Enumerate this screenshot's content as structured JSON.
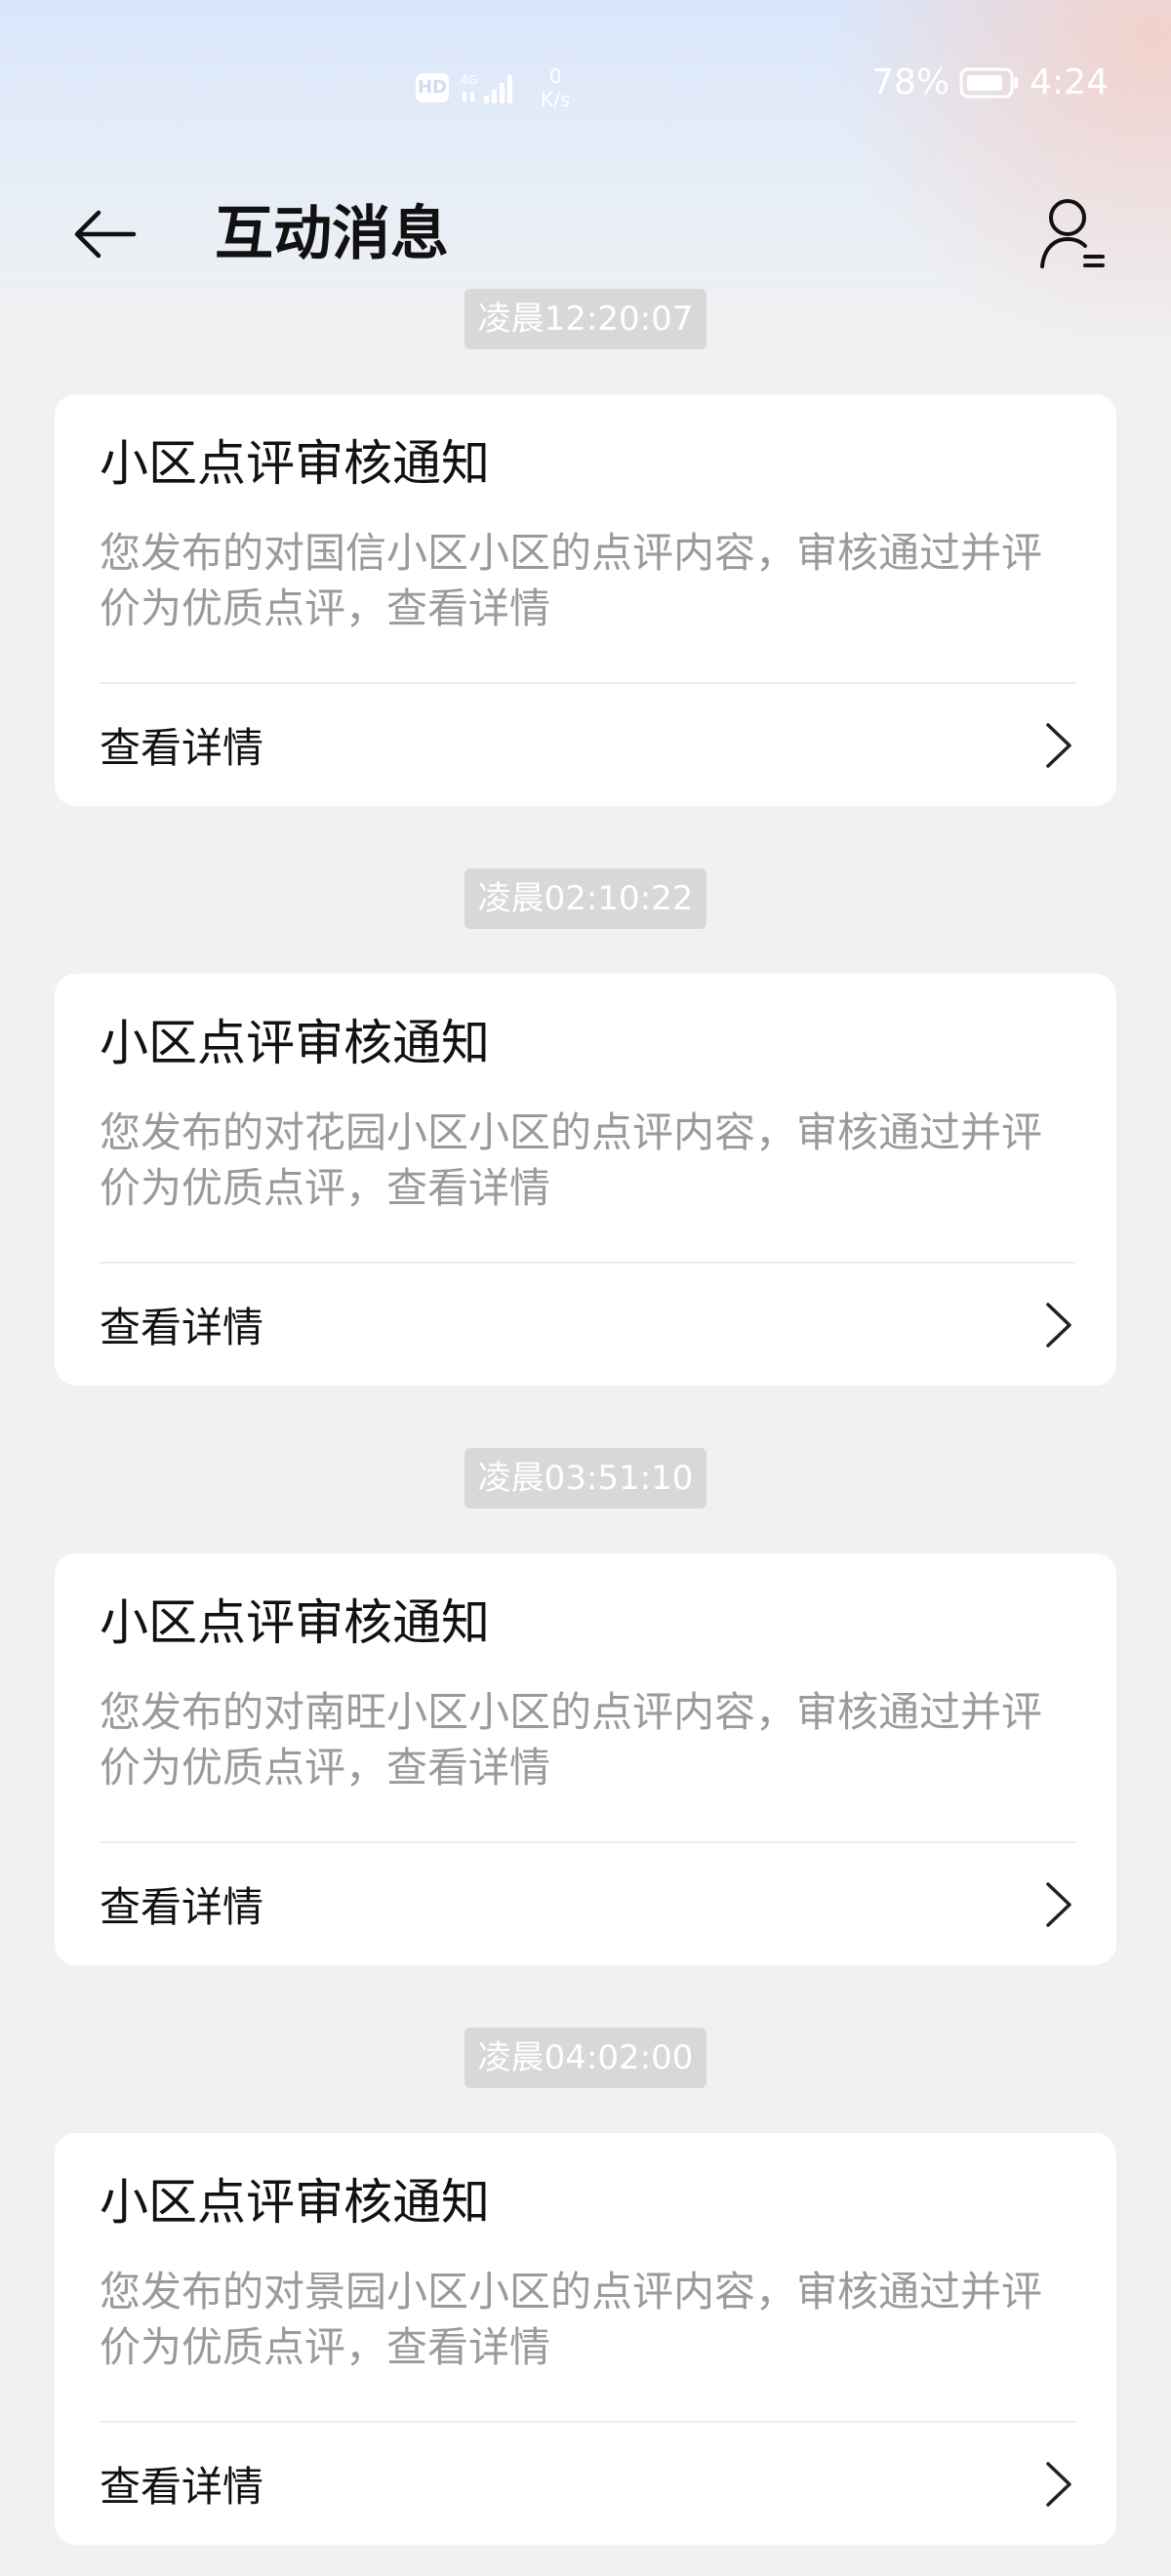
{
  "status_bar": {
    "hd": "HD",
    "network_type": "4G",
    "speed_value": "0",
    "speed_unit": "K/s",
    "battery": "78%",
    "time": "4:24"
  },
  "header": {
    "title": "互动消息"
  },
  "messages": [
    {
      "timestamp": "凌晨12:20:07",
      "title": "小区点评审核通知",
      "body": "您发布的对国信小区小区的点评内容，审核通过并评价为优质点评，查看详情",
      "action": "查看详情"
    },
    {
      "timestamp": "凌晨02:10:22",
      "title": "小区点评审核通知",
      "body": "您发布的对花园小区小区的点评内容，审核通过并评价为优质点评，查看详情",
      "action": "查看详情"
    },
    {
      "timestamp": "凌晨03:51:10",
      "title": "小区点评审核通知",
      "body": "您发布的对南旺小区小区的点评内容，审核通过并评价为优质点评，查看详情",
      "action": "查看详情"
    },
    {
      "timestamp": "凌晨04:02:00",
      "title": "小区点评审核通知",
      "body": "您发布的对景园小区小区的点评内容，审核通过并评价为优质点评，查看详情",
      "action": "查看详情"
    }
  ]
}
